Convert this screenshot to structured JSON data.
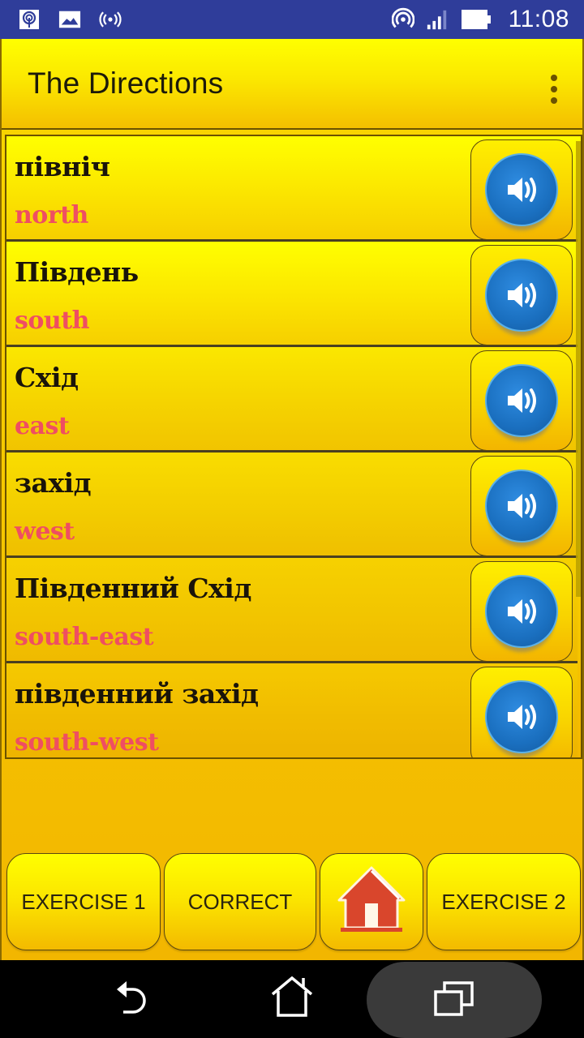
{
  "status_bar": {
    "left_icons": [
      "hotspot-icon",
      "image-icon",
      "broadcast-icon"
    ],
    "right_icons": [
      "wifi-hotspot-icon",
      "signal-icon",
      "battery-icon"
    ],
    "time": "11:08"
  },
  "toolbar": {
    "title": "The Directions",
    "overflow_icon": "more-vert-icon"
  },
  "colors": {
    "status_bar": "#2f3d9a",
    "app_background": "#f9d800",
    "native_word": "#1a140a",
    "english_word": "#ef4e62",
    "speaker_blue": "#1a6fbf",
    "home_red": "#d9462c"
  },
  "list": {
    "items": [
      {
        "native": "північ",
        "english": "north",
        "action_icon": "speaker-icon"
      },
      {
        "native": "Південь",
        "english": "south",
        "action_icon": "speaker-icon"
      },
      {
        "native": "Схід",
        "english": "east",
        "action_icon": "speaker-icon"
      },
      {
        "native": "захід",
        "english": "west",
        "action_icon": "speaker-icon"
      },
      {
        "native": "Південний Схід",
        "english": "south-east",
        "action_icon": "speaker-icon"
      },
      {
        "native": "південний захід",
        "english": "south-west",
        "action_icon": "speaker-icon"
      }
    ]
  },
  "bottom_bar": {
    "exercise1_label": "EXERCISE 1",
    "correct_label": "CORRECT",
    "home_icon": "home-icon",
    "exercise2_label": "EXERCISE 2"
  },
  "nav_bar": {
    "back_icon": "back-icon",
    "home_icon": "home-outline-icon",
    "recents_icon": "recents-icon"
  }
}
